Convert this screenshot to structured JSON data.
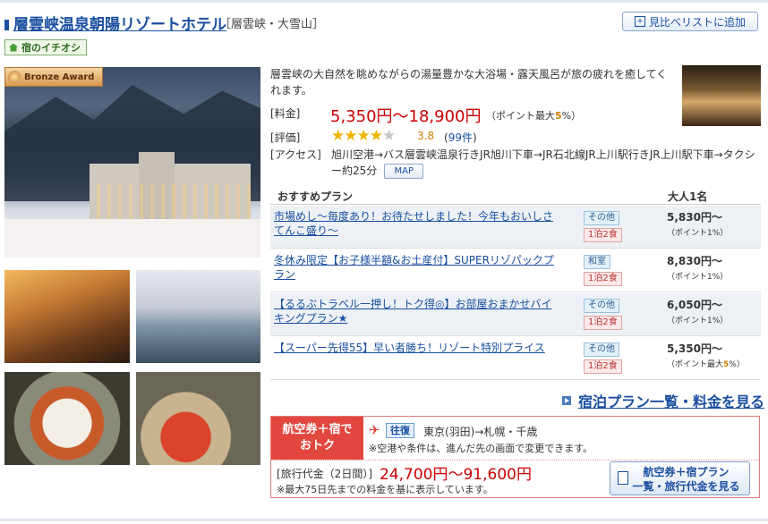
{
  "hotel": {
    "name": "層雲峡温泉朝陽リゾートホテル",
    "area": "［層雲峡・大雪山］",
    "compare_label": "見比べリストに追加",
    "ichioshi": "宿のイチオシ",
    "award": "Bronze Award",
    "description": "層雲峡の大自然を眺めながらの湯量豊かな大浴場・露天風呂が旅の疲れを癒してくれます。",
    "price_label": "[料金]",
    "price_range": "5,350円〜18,900円",
    "point_prefix": "（ポイント最大",
    "point_pct": "5",
    "point_suffix": "%）",
    "rating_label": "[評価]",
    "rating_score": "3.8",
    "rating_stars": 4,
    "rating_count": "99件",
    "access_label": "[アクセス]",
    "access_text": "旭川空港→バス層雲峡温泉行きJR旭川下車→JR石北線JR上川駅行きJR上川駅下車→タクシー約25分",
    "map_label": "MAP"
  },
  "plans_header": {
    "col1": "おすすめプラン",
    "col2": "大人1名"
  },
  "plans": [
    {
      "title": "市場めし〜毎度あり！お待たせしました！今年もおいしさてんこ盛り〜",
      "room": "その他",
      "meal": "1泊2食",
      "price": "5,830円〜",
      "point": "（ポイント1%）"
    },
    {
      "title": "冬休み限定【お子様半額&お土産付】SUPERリゾパックプラン",
      "room": "和室",
      "meal": "1泊2食",
      "price": "8,830円〜",
      "point": "（ポイント1%）"
    },
    {
      "title": "【るるぶトラベル一押し！トク得◎】お部屋おまかせバイキングプラン★",
      "room": "その他",
      "meal": "1泊2食",
      "price": "6,050円〜",
      "point": "（ポイント1%）"
    },
    {
      "title": "【スーパー先得55】早い者勝ち！リゾート特別プライス",
      "room": "その他",
      "meal": "1泊2食",
      "price": "5,350円〜",
      "point_prefix": "（ポイント最大",
      "point_pct": "5",
      "point_suffix": "%）"
    }
  ],
  "all_plans_link": "宿泊プラン一覧・料金を見る",
  "air": {
    "label_line1": "航空券＋宿で",
    "label_line2": "おトク",
    "trip_type": "往復",
    "route": "東京(羽田)→札幌・千歳",
    "note": "※空港や条件は、進んだ先の画面で変更できます。",
    "travel_label": "[旅行代金（2日間）]",
    "travel_price": "24,700円〜91,600円",
    "travel_note": "※最大75日先までの料金を基に表示しています。",
    "button_line1": "航空券＋宿プラン",
    "button_line2": "一覧・旅行代金を見る"
  }
}
